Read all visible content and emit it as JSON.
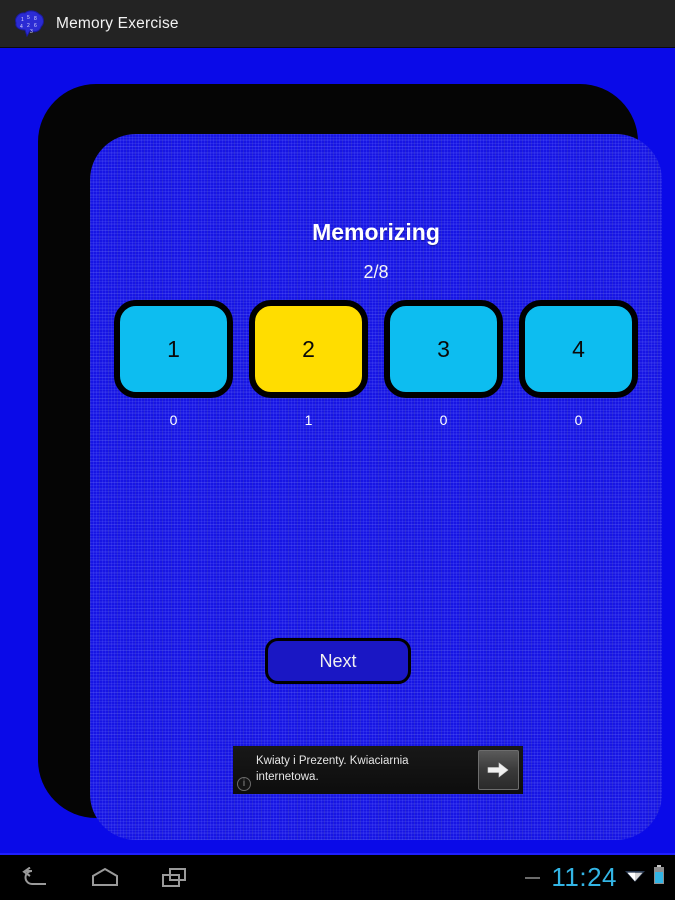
{
  "titlebar": {
    "app_icon": "brain-icon",
    "title": "Memory Exercise"
  },
  "main": {
    "heading": "Memorizing",
    "progress": "2/8",
    "tiles": [
      {
        "number": "1",
        "state": "cyan",
        "label": "0"
      },
      {
        "number": "2",
        "state": "yellow",
        "label": "1"
      },
      {
        "number": "3",
        "state": "cyan",
        "label": "0"
      },
      {
        "number": "4",
        "state": "cyan",
        "label": "0"
      }
    ],
    "next_label": "Next"
  },
  "ad": {
    "text": "Kwiaty i Prezenty. Kwiaciarnia internetowa.",
    "info_glyph": "i",
    "arrow_icon": "arrow-right-icon"
  },
  "navbar": {
    "back_icon": "back-arrow-icon",
    "home_icon": "home-icon",
    "recents_icon": "recent-apps-icon",
    "notification_icon": "notification-dash-icon",
    "clock": "11:24",
    "wifi_icon": "wifi-icon",
    "battery_icon": "battery-icon"
  },
  "colors": {
    "page_blue": "#0a0ae8",
    "panel_blue": "#1715e4",
    "tile_cyan": "#0dbdf0",
    "tile_yellow": "#ffdd00",
    "next_blue": "#1a17c4",
    "titlebar": "#232323",
    "clock_cyan": "#33b5e5"
  }
}
